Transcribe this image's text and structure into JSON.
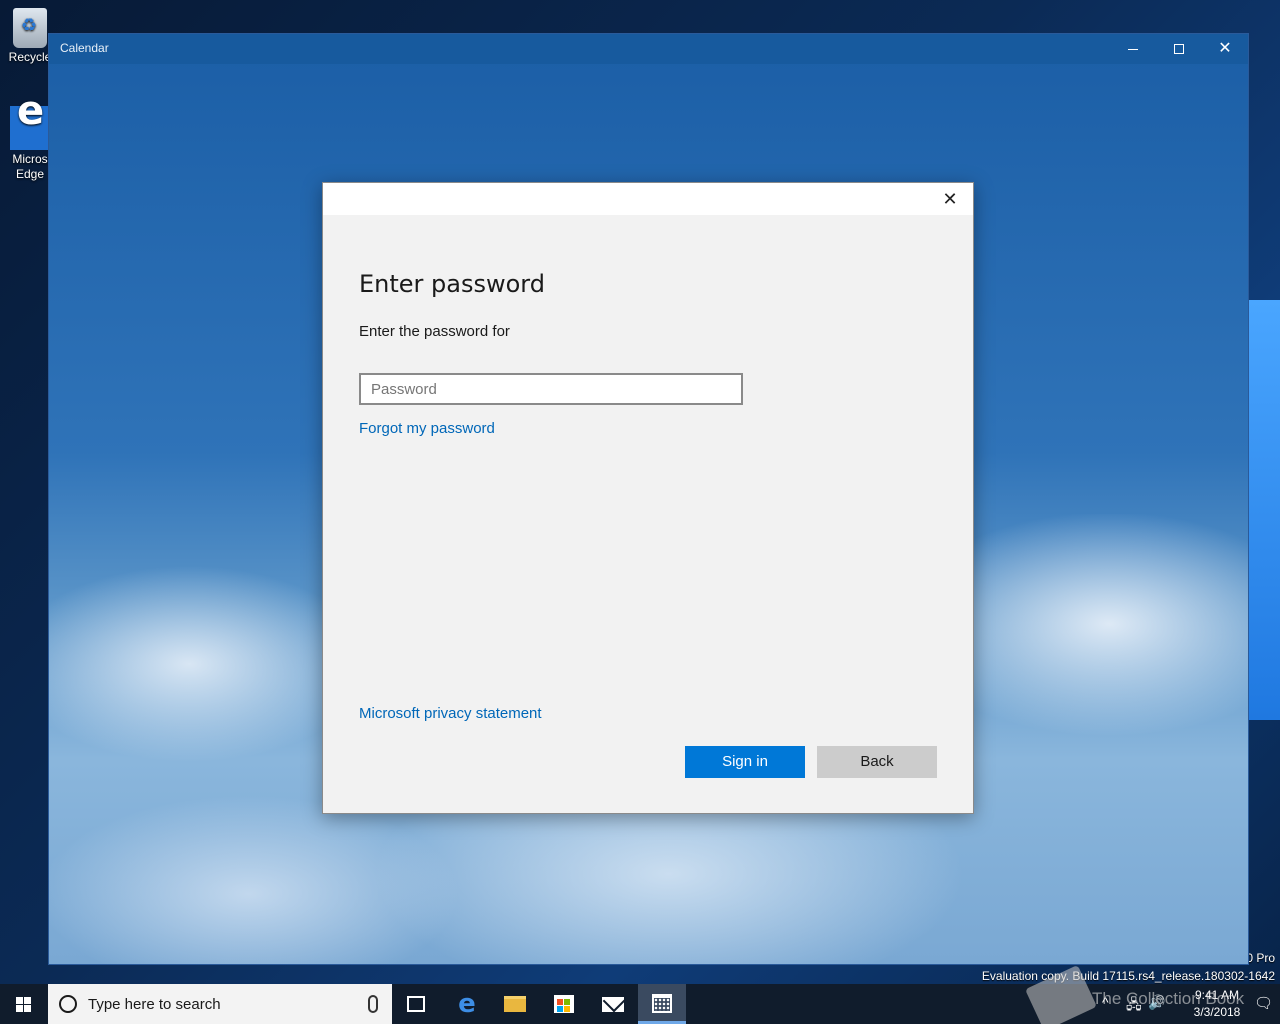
{
  "desktop": {
    "icons": [
      {
        "label": "Recycle"
      },
      {
        "label_line1": "Micros",
        "label_line2": "Edge"
      }
    ],
    "edition": "0 Pro",
    "evaluation": "Evaluation copy. Build 17115.rs4_release.180302-1642"
  },
  "window": {
    "title": "Calendar",
    "minimize_glyph": "—",
    "maximize_glyph": "☐",
    "close_glyph": "✕"
  },
  "dialog": {
    "close_glyph": "✕",
    "heading": "Enter password",
    "subtitle": "Enter the password for",
    "password": {
      "value": "",
      "placeholder": "Password"
    },
    "forgot_link": "Forgot my password",
    "privacy_link": "Microsoft privacy statement",
    "signin_label": "Sign in",
    "back_label": "Back",
    "colors": {
      "accent": "#0078d7",
      "link": "#0067b8",
      "back_button": "#cccccc"
    }
  },
  "taskbar": {
    "search_placeholder": "Type here to search",
    "pinned": [
      "task-view-icon",
      "edge-icon",
      "file-explorer-icon",
      "store-icon",
      "mail-icon",
      "calendar-icon"
    ],
    "active_app": "Calendar",
    "tray": {
      "chevron": "^",
      "network": "🖧",
      "volume": "🔊",
      "time": "9:41 AM",
      "date": "3/3/2018",
      "notification": "🗨"
    },
    "watermark": "The Collection Book"
  }
}
